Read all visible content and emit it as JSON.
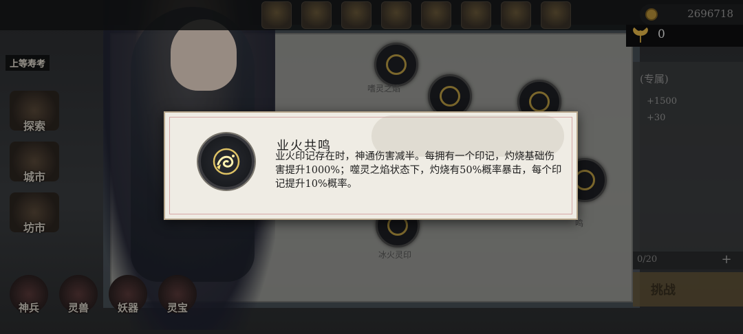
{
  "header": {
    "currency_value": "2696718",
    "premium_value": "0",
    "title_tag": "上等寿考"
  },
  "left_nav": {
    "items": [
      {
        "label": "探索"
      },
      {
        "label": "城市"
      },
      {
        "label": "坊市"
      }
    ]
  },
  "bottom_nav": {
    "items": [
      {
        "label": "神兵"
      },
      {
        "label": "灵兽"
      },
      {
        "label": "妖器"
      },
      {
        "label": "灵宝"
      }
    ]
  },
  "skill_tree": {
    "nodes": [
      {
        "label": "嗜灵之焰"
      },
      {
        "label": "冰火灵印"
      },
      {
        "label": "鸣"
      }
    ]
  },
  "right_panel": {
    "exclusive_label": "(专属)",
    "stat_1": "+1500",
    "stat_2": "+30",
    "counter": "0/20",
    "plus_symbol": "+",
    "challenge_label": "挑战"
  },
  "tooltip": {
    "title": "业火共鸣",
    "description": "业火印记存在时，神通伤害减半。每拥有一个印记，灼烧基础伤害提升1000%；噬灵之焰状态下，灼烧有50%概率暴击，每个印记提升10%概率。",
    "icon": "flame-swirl-icon"
  }
}
